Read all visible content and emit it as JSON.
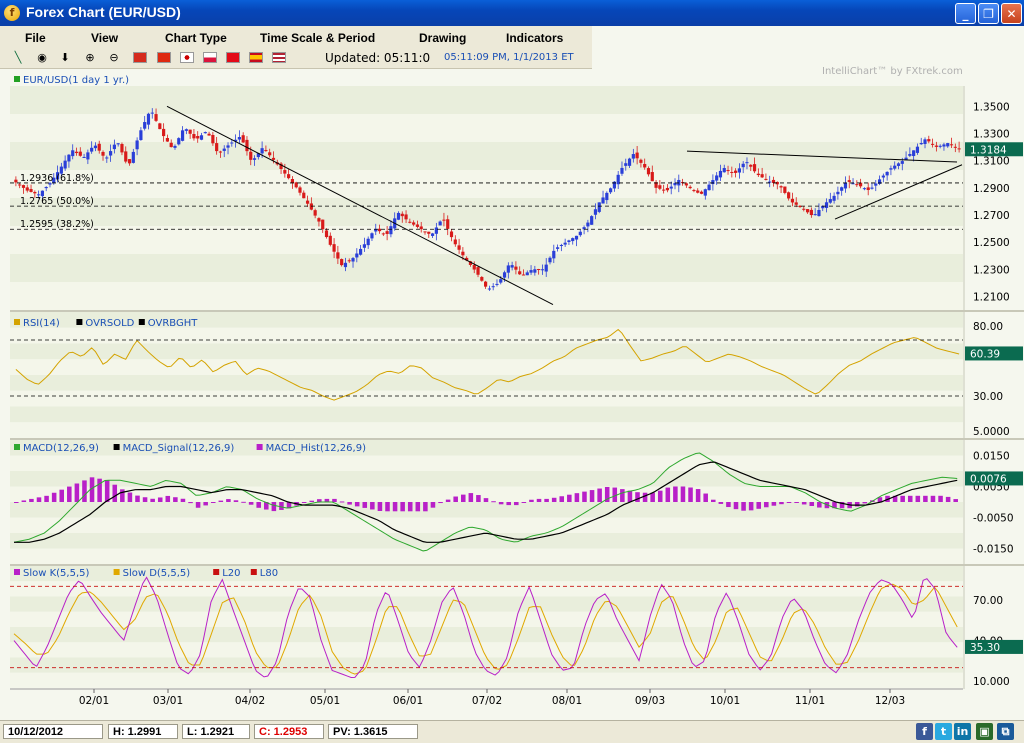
{
  "window": {
    "title": "Forex Chart (EUR/USD)",
    "app_icon": "f"
  },
  "menu": [
    "File",
    "View",
    "Chart Type",
    "Time Scale & Period",
    "Drawing",
    "Indicators"
  ],
  "toolbar": {
    "updated": "Updated: 05:11:0",
    "timestamp": "05:11:09 PM, 1/1/2013 ET",
    "icons": [
      "line-tool-icon",
      "target-icon",
      "down-arrow-icon",
      "zoom-in-icon",
      "zoom-out-icon"
    ],
    "flags": [
      "china",
      "hong-kong",
      "japan",
      "poland",
      "turkey",
      "spain",
      "usa"
    ]
  },
  "watermark": "IntelliChart™ by FXtrek.com",
  "status": {
    "date": "10/12/2012",
    "high": "H: 1.2991",
    "low": "L: 1.2921",
    "close": "C: 1.2953",
    "pv": "PV: 1.3615"
  },
  "colors": {
    "up": "#2a3fd8",
    "down": "#d81a1a",
    "rsi": "#d4a300",
    "macd_line": "#2ea82e",
    "signal": "#000000",
    "hist": "#b820c8",
    "stoch_k": "#b820c8",
    "stoch_d": "#e0a800",
    "badge": "#0b6b50"
  },
  "chart_data": [
    {
      "type": "candlestick",
      "title": "EUR/USD(1 day  1 yr.)",
      "x_labels": [
        "02/01",
        "03/01",
        "04/02",
        "05/01",
        "06/01",
        "07/02",
        "08/01",
        "09/03",
        "10/01",
        "11/01",
        "12/03"
      ],
      "y_ticks": [
        "1.3500",
        "1.3300",
        "1.3100",
        "1.2900",
        "1.2700",
        "1.2500",
        "1.2300",
        "1.2100"
      ],
      "ylim": [
        1.2,
        1.365
      ],
      "last_value": "1.3184",
      "fib_levels": [
        {
          "value": 1.2936,
          "label": "1.2936 (61.8%)"
        },
        {
          "value": 1.2765,
          "label": "1.2765 (50.0%)"
        },
        {
          "value": 1.2595,
          "label": "1.2595 (38.2%)"
        }
      ],
      "closes_approx": [
        [
          1.294,
          1.288,
          1.285,
          1.293,
          1.305,
          1.318,
          1.312,
          1.322,
          1.311,
          1.325,
          1.305,
          1.33,
          1.348,
          1.33,
          1.318,
          1.335,
          1.325,
          1.332,
          1.315,
          1.322,
          1.328,
          1.309,
          1.32,
          1.31,
          1.3,
          1.29,
          1.278,
          1.265,
          1.248,
          1.233
        ],
        [
          1.238,
          1.248,
          1.26,
          1.255,
          1.272,
          1.265,
          1.26,
          1.255,
          1.268,
          1.25,
          1.238,
          1.228,
          1.215,
          1.22,
          1.235,
          1.225,
          1.23,
          1.23,
          1.245,
          1.25,
          1.255,
          1.265,
          1.28,
          1.29,
          1.305,
          1.315,
          1.305,
          1.29,
          1.288,
          1.296
        ],
        [
          1.29,
          1.285,
          1.295,
          1.305,
          1.3,
          1.31,
          1.3,
          1.295,
          1.292,
          1.28,
          1.275,
          1.269,
          1.278,
          1.285,
          1.295,
          1.292,
          1.288,
          1.297,
          1.305,
          1.31,
          1.318,
          1.326,
          1.32,
          1.323,
          1.3184
        ]
      ]
    },
    {
      "type": "line",
      "title": "RSI(14)",
      "series": [
        {
          "name": "RSI(14)"
        },
        {
          "name": "OVRSOLD"
        },
        {
          "name": "OVRBGHT"
        }
      ],
      "y_ticks": [
        "80.00",
        "30.00",
        "5.0000"
      ],
      "levels": {
        "overbought": 70,
        "oversold": 30
      },
      "ylim": [
        0,
        90
      ],
      "last_value": "60.39",
      "values_approx": [
        49,
        42,
        38,
        45,
        55,
        62,
        58,
        65,
        52,
        60,
        56,
        70,
        62,
        55,
        50,
        58,
        50,
        56,
        47,
        52,
        55,
        45,
        50,
        48,
        44,
        40,
        36,
        34,
        30,
        27,
        30,
        33,
        38,
        45,
        48,
        46,
        52,
        50,
        43,
        40,
        36,
        34,
        31,
        36,
        42,
        40,
        44,
        46,
        50,
        55,
        58,
        64,
        67,
        70,
        72,
        78,
        66,
        55,
        57,
        60,
        62,
        66,
        60,
        54,
        57,
        60,
        58,
        55,
        51,
        48,
        45,
        40,
        35,
        31,
        38,
        46,
        52,
        55,
        60,
        64,
        68,
        70,
        72,
        68,
        64,
        62,
        60
      ]
    },
    {
      "type": "line",
      "title": "MACD(12,26,9)",
      "series": [
        {
          "name": "MACD(12,26,9)"
        },
        {
          "name": "MACD_Signal(12,26,9)"
        },
        {
          "name": "MACD_Hist(12,26,9)"
        }
      ],
      "y_ticks": [
        "0.0150",
        "0.0050",
        "-0.0050",
        "-0.0150"
      ],
      "ylim": [
        -0.02,
        0.02
      ],
      "last_value": "0.0076",
      "macd_approx": [
        -0.013,
        -0.012,
        -0.01,
        -0.006,
        -0.001,
        0.004,
        0.007,
        0.007,
        0.006,
        0.005,
        0.007,
        0.006,
        0.002,
        0.003,
        0.005,
        0.004,
        0.001,
        -0.001,
        -0.002,
        -0.001,
        0.0,
        0.0,
        -0.003,
        -0.006,
        -0.009,
        -0.012,
        -0.014,
        -0.016,
        -0.013,
        -0.01,
        -0.008,
        -0.009,
        -0.012,
        -0.013,
        -0.011,
        -0.01,
        -0.008,
        -0.005,
        -0.002,
        0.001,
        0.003,
        0.004,
        0.006,
        0.011,
        0.014,
        0.016,
        0.013,
        0.009,
        0.006,
        0.005,
        0.005,
        0.005,
        0.003,
        0.0,
        -0.002,
        -0.003,
        -0.001,
        0.002,
        0.004,
        0.006,
        0.007,
        0.008,
        0.0076
      ],
      "signal_approx": [
        -0.013,
        -0.013,
        -0.012,
        -0.01,
        -0.007,
        -0.004,
        0.0,
        0.003,
        0.004,
        0.004,
        0.005,
        0.005,
        0.004,
        0.003,
        0.004,
        0.004,
        0.003,
        0.002,
        0.0,
        -0.001,
        -0.001,
        -0.001,
        -0.002,
        -0.004,
        -0.006,
        -0.009,
        -0.011,
        -0.013,
        -0.013,
        -0.012,
        -0.011,
        -0.01,
        -0.011,
        -0.012,
        -0.012,
        -0.011,
        -0.01,
        -0.008,
        -0.006,
        -0.004,
        -0.001,
        0.001,
        0.003,
        0.006,
        0.009,
        0.012,
        0.013,
        0.011,
        0.009,
        0.007,
        0.006,
        0.005,
        0.004,
        0.002,
        0.0,
        -0.001,
        -0.001,
        0.0,
        0.002,
        0.004,
        0.005,
        0.006,
        0.007
      ]
    },
    {
      "type": "line",
      "title": "Slow K(5,5,5)",
      "series": [
        {
          "name": "Slow K(5,5,5)"
        },
        {
          "name": "Slow D(5,5,5)"
        },
        {
          "name": "L20"
        },
        {
          "name": "L80"
        }
      ],
      "y_ticks": [
        "70.00",
        "40.00",
        "10.000"
      ],
      "levels": {
        "L20": 20,
        "L80": 80
      },
      "ylim": [
        5,
        95
      ],
      "last_value": "35.30",
      "k_approx": [
        40,
        30,
        20,
        35,
        55,
        75,
        85,
        72,
        60,
        50,
        40,
        65,
        88,
        72,
        45,
        20,
        15,
        30,
        70,
        85,
        62,
        40,
        18,
        12,
        25,
        60,
        80,
        72,
        40,
        18,
        15,
        12,
        22,
        60,
        78,
        55,
        30,
        20,
        40,
        68,
        80,
        60,
        32,
        18,
        14,
        28,
        62,
        80,
        55,
        30,
        18,
        20,
        50,
        70,
        75,
        55,
        40,
        25,
        58,
        82,
        70,
        40,
        20,
        25,
        60,
        76,
        55,
        30,
        18,
        28,
        56,
        72,
        62,
        40,
        22,
        16,
        30,
        55,
        75,
        85,
        82,
        70,
        55,
        88,
        78,
        45,
        35
      ],
      "d_approx": [
        45,
        38,
        30,
        30,
        42,
        60,
        75,
        76,
        68,
        58,
        48,
        55,
        72,
        75,
        60,
        38,
        22,
        22,
        45,
        68,
        72,
        55,
        32,
        20,
        20,
        40,
        65,
        74,
        58,
        32,
        20,
        15,
        18,
        40,
        65,
        65,
        45,
        28,
        30,
        50,
        70,
        68,
        48,
        28,
        18,
        22,
        42,
        65,
        65,
        45,
        28,
        20,
        35,
        58,
        70,
        65,
        50,
        35,
        45,
        68,
        74,
        56,
        35,
        25,
        40,
        62,
        64,
        46,
        28,
        24,
        40,
        60,
        64,
        52,
        34,
        22,
        24,
        40,
        60,
        78,
        82,
        78,
        66,
        70,
        80,
        65,
        50
      ]
    }
  ]
}
